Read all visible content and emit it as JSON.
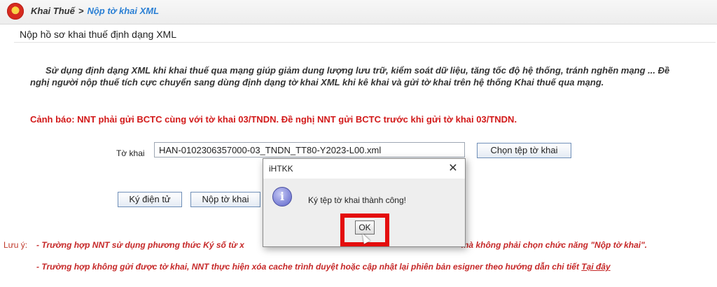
{
  "breadcrumb": {
    "root": "Khai Thuế",
    "separator": ">",
    "current": "Nộp tờ khai XML"
  },
  "section_title": "Nộp hồ sơ khai thuế định dạng XML",
  "intro_text": "Sử dụng định dạng XML khi khai thuế qua mạng giúp giảm dung lượng lưu trữ, kiểm soát dữ liệu, tăng tốc độ hệ thống, tránh nghẽn mạng ... Đề nghị người nộp thuế tích cực chuyển sang dùng định dạng tờ khai XML khi kê khai và gửi tờ khai trên hệ thống Khai thuế qua mạng.",
  "warning_text": "Cảnh báo: NNT phải gửi BCTC cùng với tờ khai 03/TNDN. Đề nghị NNT gửi BCTC trước khi gửi tờ khai 03/TNDN.",
  "form": {
    "file_label": "Tờ khai",
    "file_value": "HAN-0102306357000-03_TNDN_TT80-Y2023-L00.xml",
    "choose_button": "Chọn tệp tờ khai",
    "sign_button": "Ký điện tử",
    "submit_button": "Nộp tờ khai"
  },
  "notes": {
    "heading": "Lưu ý:",
    "note1": "- Trường hợp NNT sử dụng phương thức Ký số từ x",
    "note1_tail": "mà không phải chọn chức năng \"Nộp tờ khai\".",
    "note2": "- Trường hợp không gửi được tờ khai, NNT thực hiện xóa cache trình duyệt hoặc cập nhật lại phiên bản esigner theo hướng dẫn chi tiết",
    "note2_link": "Tại đây"
  },
  "dialog": {
    "title": "iHTKK",
    "close_icon": "close-icon",
    "message": "Ký tệp tờ khai thành công!",
    "ok_button": "OK",
    "icon": "info-icon",
    "icon_glyph": "i"
  },
  "colors": {
    "warning": "#d21919",
    "link": "#2a7fd4",
    "highlight": "#e40d0d",
    "note": "#c62828"
  }
}
